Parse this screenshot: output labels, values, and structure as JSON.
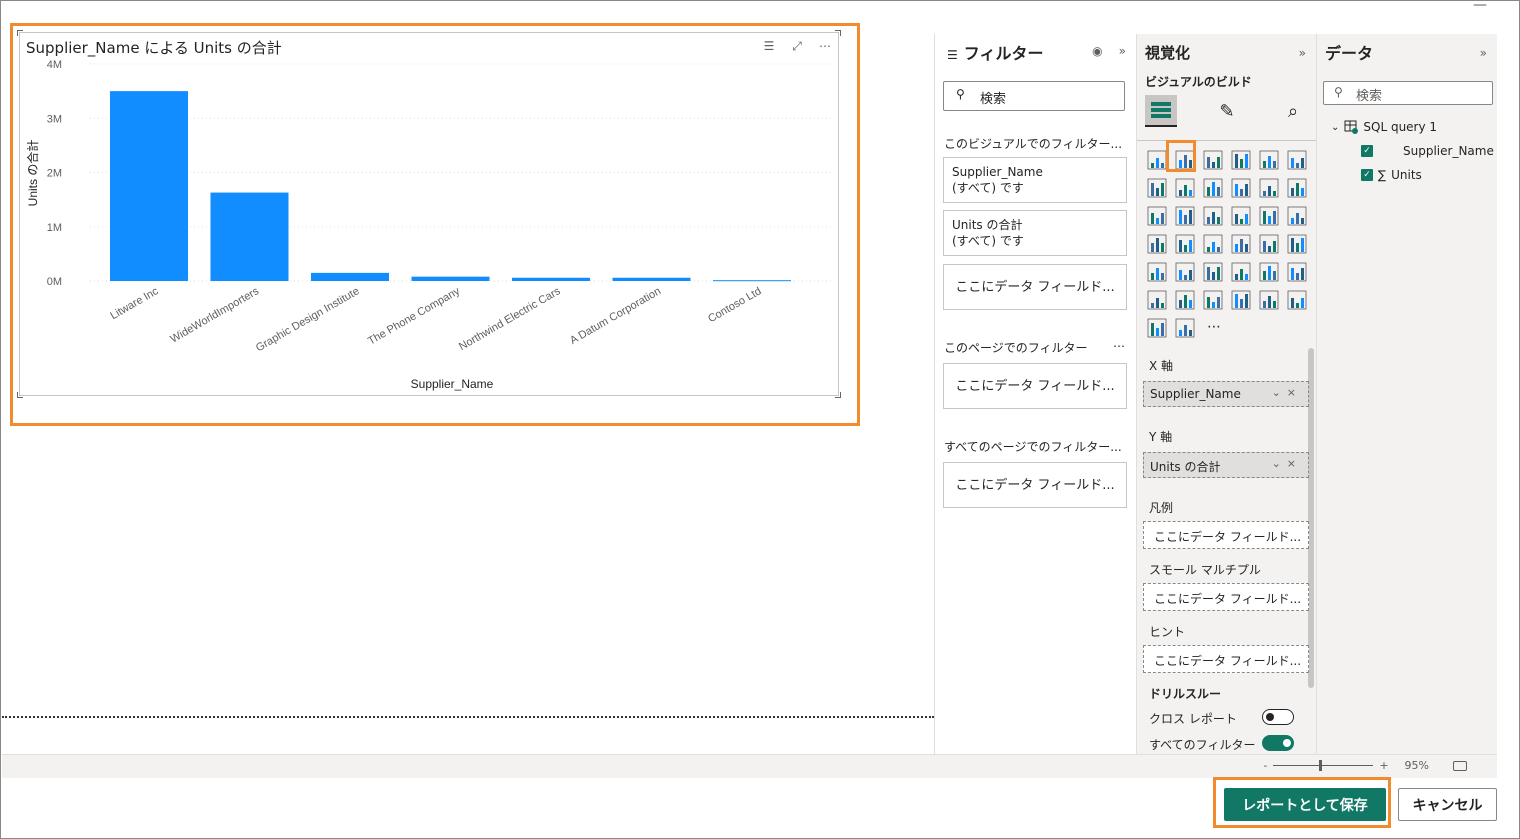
{
  "visual": {
    "title": "Supplier_Name による Units の合計",
    "tool_icons": [
      "filter-icon",
      "focus-mode-icon",
      "more-options-icon"
    ]
  },
  "chart_data": {
    "type": "bar",
    "title": "Supplier_Name による Units の合計",
    "xlabel": "Supplier_Name",
    "ylabel": "Units の合計",
    "categories": [
      "Litware Inc",
      "WideWorldImporters",
      "Graphic Design Institute",
      "The Phone Company",
      "Northwind Electric Cars",
      "A Datum Corporation",
      "Contoso Ltd"
    ],
    "values": [
      3500000,
      1630000,
      150000,
      80000,
      60000,
      60000,
      15000
    ],
    "yticks": [
      "0M",
      "1M",
      "2M",
      "3M",
      "4M"
    ],
    "ylim": [
      0,
      4000000
    ],
    "grid": true,
    "bar_color": "#118dff"
  },
  "filters": {
    "title": "フィルター",
    "search_placeholder": "検索",
    "visual_section": "このビジュアルでのフィルター...",
    "visual_cards": [
      {
        "field": "Supplier_Name",
        "state": "(すべて) です"
      },
      {
        "field": "Units の合計",
        "state": "(すべて) です"
      }
    ],
    "drop_text": "ここにデータ フィールド...",
    "page_section": "このページでのフィルター",
    "all_pages_section": "すべてのページでのフィルター..."
  },
  "visualizations": {
    "title": "視覚化",
    "build_label": "ビジュアルのビルド",
    "x_axis_label": "X 軸",
    "x_axis_field": "Supplier_Name",
    "y_axis_label": "Y 軸",
    "y_axis_field": "Units の合計",
    "legend_label": "凡例",
    "small_multiples_label": "スモール マルチプル",
    "tooltips_label": "ヒント",
    "drop_text": "ここにデータ フィールド...",
    "drillthrough_label": "ドリルスルー",
    "cross_report_label": "クロス レポート",
    "keep_all_filters_label": "すべてのフィルター",
    "more": "..."
  },
  "data": {
    "title": "データ",
    "search_placeholder": "検索",
    "table_name": "SQL query 1",
    "fields": [
      {
        "name": "Supplier_Name",
        "checked": true,
        "sigma": ""
      },
      {
        "name": "Units",
        "checked": true,
        "sigma": "∑"
      }
    ]
  },
  "status": {
    "zoom_minus": "-",
    "zoom_plus": "+",
    "zoom_level": "95%"
  },
  "buttons": {
    "save": "レポートとして保存",
    "cancel": "キャンセル"
  },
  "colors": {
    "accent": "#117865",
    "highlight": "#f28a2e",
    "bar": "#118dff"
  }
}
